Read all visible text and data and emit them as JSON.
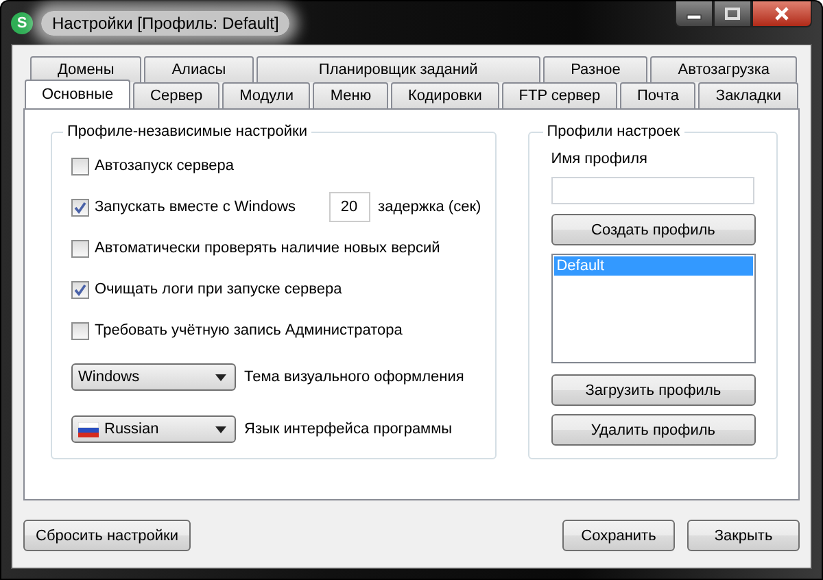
{
  "window": {
    "title": "Настройки [Профиль: Default]",
    "icon_letter": "S"
  },
  "tab_rows": [
    [
      {
        "label": "Домены",
        "selected": false
      },
      {
        "label": "Алиасы",
        "selected": false
      },
      {
        "label": "Планировщик заданий",
        "selected": false
      },
      {
        "label": "Разное",
        "selected": false
      },
      {
        "label": "Автозагрузка",
        "selected": false
      }
    ],
    [
      {
        "label": "Основные",
        "selected": true
      },
      {
        "label": "Сервер",
        "selected": false
      },
      {
        "label": "Модули",
        "selected": false
      },
      {
        "label": "Меню",
        "selected": false
      },
      {
        "label": "Кодировки",
        "selected": false
      },
      {
        "label": "FTP сервер",
        "selected": false
      },
      {
        "label": "Почта",
        "selected": false
      },
      {
        "label": "Закладки",
        "selected": false
      }
    ]
  ],
  "general": {
    "title": "Профиле-независимые настройки",
    "options": [
      {
        "label": "Автозапуск сервера",
        "checked": false
      },
      {
        "label": "Запускать вместе с Windows",
        "checked": true,
        "delay": "20",
        "delay_label": "задержка (сек)"
      },
      {
        "label": "Автоматически проверять наличие новых версий",
        "checked": false
      },
      {
        "label": "Очищать логи при запуске сервера",
        "checked": true
      },
      {
        "label": "Требовать учётную запись Администратора",
        "checked": false
      }
    ],
    "selects": [
      {
        "kind": "plain",
        "value": "Windows",
        "label": "Тема визуального оформления"
      },
      {
        "kind": "flag",
        "value": "Russian",
        "label": "Язык интерфейса программы"
      }
    ]
  },
  "profiles": {
    "title": "Профили настроек",
    "name_label": "Имя профиля",
    "create_button": "Создать профиль",
    "list": [
      {
        "label": "Default",
        "selected": true
      }
    ],
    "buttons": [
      "Загрузить профиль",
      "Удалить профиль"
    ]
  },
  "footer": {
    "reset_button": "Сбросить настройки",
    "buttons": [
      "Сохранить",
      "Закрыть"
    ]
  }
}
